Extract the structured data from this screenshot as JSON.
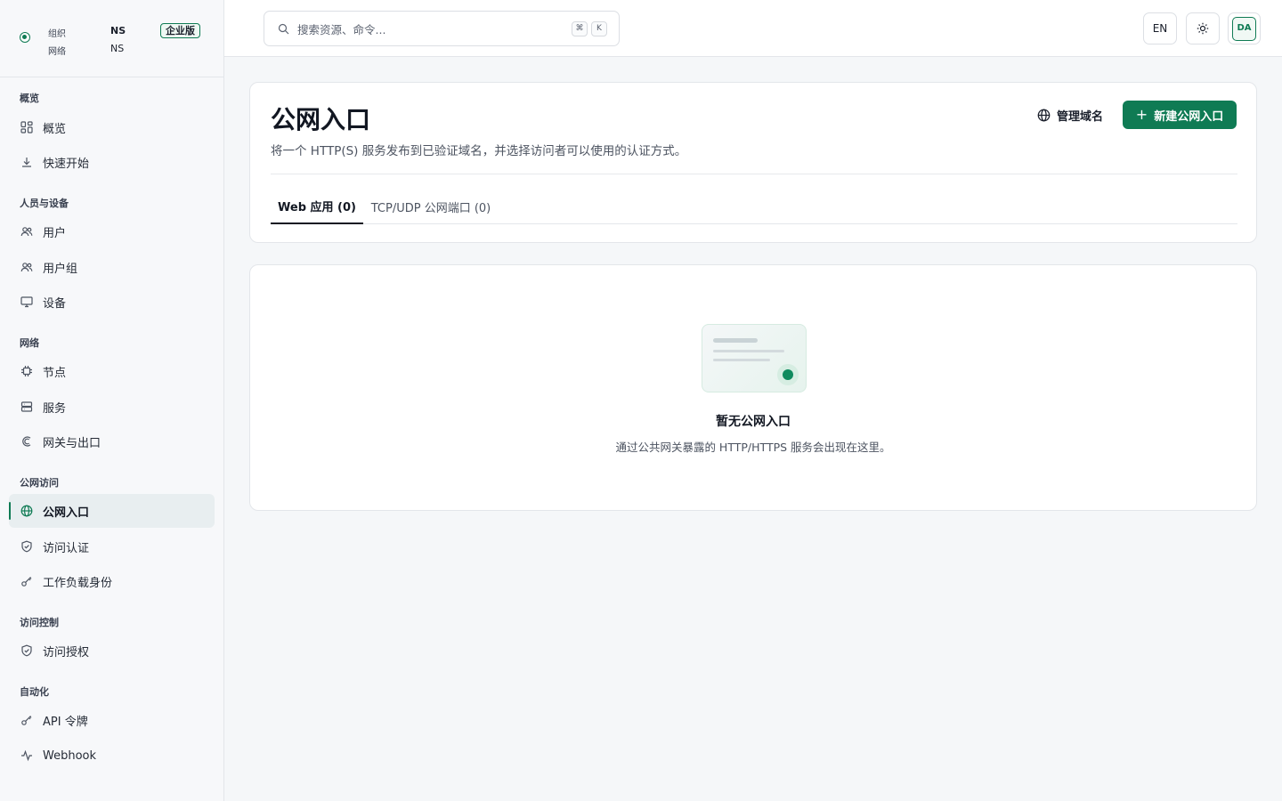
{
  "org": {
    "label_org": "组织",
    "value_org": "NS",
    "label_network": "网络",
    "value_network": "NS",
    "badge": "企业版"
  },
  "sidebar": {
    "sections": {
      "overview": "概览",
      "people": "人员与设备",
      "network": "网络",
      "public": "公网访问",
      "access": "访问控制",
      "automation": "自动化"
    },
    "items": {
      "overview": "概览",
      "quickstart": "快速开始",
      "users": "用户",
      "groups": "用户组",
      "devices": "设备",
      "nodes": "节点",
      "services": "服务",
      "gateways": "网关与出口",
      "ingress": "公网入口",
      "auth": "访问认证",
      "workload": "工作负载身份",
      "grants": "访问授权",
      "api_tokens": "API 令牌",
      "webhook": "Webhook"
    },
    "active": "ingress"
  },
  "topbar": {
    "search_placeholder": "搜索资源、命令...",
    "kbd_mod": "⌘",
    "kbd_key": "K",
    "lang": "EN",
    "avatar": "DA"
  },
  "page": {
    "title": "公网入口",
    "description": "将一个 HTTP(S) 服务发布到已验证域名，并选择访问者可以使用的认证方式。",
    "manage_label": "管理域名",
    "new_label": "新建公网入口",
    "tabs": [
      {
        "label": "Web 应用 (0)",
        "active": true
      },
      {
        "label": "TCP/UDP 公网端口 (0)",
        "active": false
      }
    ]
  },
  "empty": {
    "title": "暂无公网入口",
    "description": "通过公共网关暴露的 HTTP/HTTPS 服务会出现在这里。"
  },
  "colors": {
    "accent": "#0f7b54",
    "active_nav_bg": "#e8eef0"
  }
}
